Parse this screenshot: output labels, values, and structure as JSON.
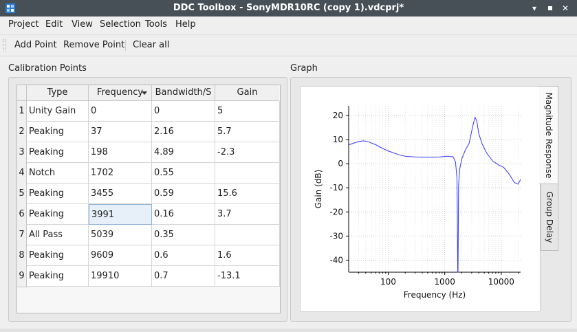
{
  "window": {
    "title": "DDC Toolbox - SonyMDR10RC (copy 1).vdcprj*"
  },
  "menu": [
    "Project",
    "Edit",
    "View",
    "Selection",
    "Tools",
    "Help"
  ],
  "toolbar": {
    "add": "Add Point",
    "remove": "Remove Point",
    "clear": "Clear all"
  },
  "calibration": {
    "label": "Calibration Points",
    "headers": [
      "Type",
      "Frequency",
      "Bandwidth/S",
      "Gain"
    ],
    "rows": [
      {
        "n": "1",
        "type": "Unity Gain",
        "freq": "0",
        "bw": "0",
        "gain": "5"
      },
      {
        "n": "2",
        "type": "Peaking",
        "freq": "37",
        "bw": "2.16",
        "gain": "5.7"
      },
      {
        "n": "3",
        "type": "Peaking",
        "freq": "198",
        "bw": "4.89",
        "gain": "-2.3"
      },
      {
        "n": "4",
        "type": "Notch",
        "freq": "1702",
        "bw": "0.55",
        "gain": ""
      },
      {
        "n": "5",
        "type": "Peaking",
        "freq": "3455",
        "bw": "0.59",
        "gain": "15.6"
      },
      {
        "n": "6",
        "type": "Peaking",
        "freq": "3991",
        "bw": "0.16",
        "gain": "3.7"
      },
      {
        "n": "7",
        "type": "All Pass",
        "freq": "5039",
        "bw": "0.35",
        "gain": ""
      },
      {
        "n": "8",
        "type": "Peaking",
        "freq": "9609",
        "bw": "0.6",
        "gain": "1.6"
      },
      {
        "n": "9",
        "type": "Peaking",
        "freq": "19910",
        "bw": "0.7",
        "gain": "-13.1"
      }
    ]
  },
  "graph": {
    "label": "Graph",
    "tabs": [
      "Magnitude Response",
      "Group Delay"
    ]
  },
  "chart_data": {
    "type": "line",
    "xlabel": "Frequency (Hz)",
    "ylabel": "Gain (dB)",
    "xscale": "log",
    "xlim": [
      20,
      22000
    ],
    "ylim": [
      -45,
      24
    ],
    "xticks": [
      100,
      1000,
      10000
    ],
    "xtick_labels": [
      "100",
      "1000",
      "10000"
    ],
    "yticks": [
      20,
      10,
      0,
      -10,
      -20,
      -30,
      -40
    ],
    "ytick_labels": [
      "20",
      "10",
      "0",
      "-10",
      "-20",
      "-30",
      "-40"
    ],
    "grid": true,
    "line_color": "#3333ff",
    "x": [
      20,
      25,
      30,
      37,
      45,
      60,
      80,
      100,
      150,
      200,
      300,
      500,
      800,
      1100,
      1400,
      1550,
      1650,
      1700,
      1720,
      1760,
      1850,
      2000,
      2300,
      2700,
      3100,
      3300,
      3455,
      3700,
      4000,
      4600,
      5500,
      7000,
      9000,
      11000,
      14000,
      17000,
      19910,
      22000
    ],
    "y": [
      7.8,
      8.6,
      9.2,
      9.5,
      9.1,
      7.9,
      6.3,
      5.3,
      3.8,
      3.1,
      2.8,
      2.7,
      2.8,
      3.1,
      2.9,
      0.8,
      -6,
      -45,
      -45,
      -9,
      -2,
      2,
      5.5,
      8.5,
      15,
      17.8,
      19.2,
      17.5,
      12.5,
      8.2,
      4.5,
      1.2,
      -0.5,
      -1.5,
      -4.5,
      -7.8,
      -8.5,
      -6.5
    ]
  }
}
